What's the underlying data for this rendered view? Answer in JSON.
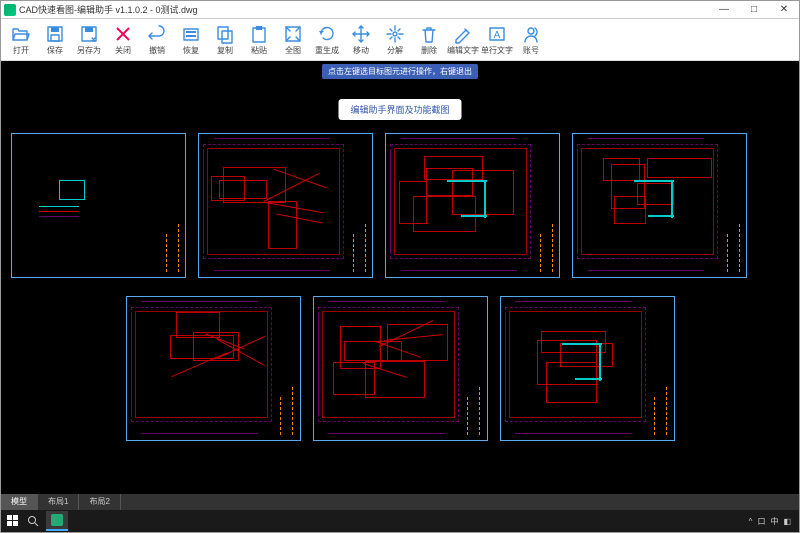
{
  "titlebar": {
    "title": "CAD快速看图-编辑助手 v1.1.0.2 - 0测试.dwg",
    "min": "—",
    "max": "□",
    "close": "✕"
  },
  "toolbar": {
    "items": [
      {
        "icon": "open",
        "label": "打开",
        "color": "#3a8dde"
      },
      {
        "icon": "save",
        "label": "保存",
        "color": "#3a8dde"
      },
      {
        "icon": "saveas",
        "label": "另存为",
        "color": "#3a8dde"
      },
      {
        "icon": "close",
        "label": "关闭",
        "color": "#e05"
      },
      {
        "icon": "undo",
        "label": "撤销",
        "color": "#3a8dde"
      },
      {
        "icon": "redo",
        "label": "恢复",
        "color": "#3a8dde"
      },
      {
        "icon": "copy",
        "label": "复制",
        "color": "#3a8dde"
      },
      {
        "icon": "paste",
        "label": "粘贴",
        "color": "#3a8dde"
      },
      {
        "icon": "extents",
        "label": "全图",
        "color": "#3a8dde"
      },
      {
        "icon": "regen",
        "label": "重生成",
        "color": "#3a8dde"
      },
      {
        "icon": "move",
        "label": "移动",
        "color": "#3a8dde"
      },
      {
        "icon": "explode",
        "label": "分解",
        "color": "#3a8dde"
      },
      {
        "icon": "delete",
        "label": "删除",
        "color": "#3a8dde"
      },
      {
        "icon": "mtext",
        "label": "编辑文字",
        "color": "#3a8dde"
      },
      {
        "icon": "text",
        "label": "单行文字",
        "color": "#3a8dde"
      },
      {
        "icon": "account",
        "label": "账号",
        "color": "#3a8dde"
      }
    ]
  },
  "canvas": {
    "hint": "点击左键选目标图元进行操作，右键退出",
    "caption": "编辑助手界面及功能截图"
  },
  "tabs": {
    "items": [
      "模型",
      "布局1",
      "布局2"
    ],
    "active": 0
  },
  "tray": {
    "icons": [
      "^",
      "口",
      "中",
      "◧"
    ]
  },
  "colors": {
    "accent": "#3a8dde",
    "frame": "#55aaee",
    "wall": "#bb0000",
    "dim": "#660066",
    "pipe": "#00cccc"
  }
}
